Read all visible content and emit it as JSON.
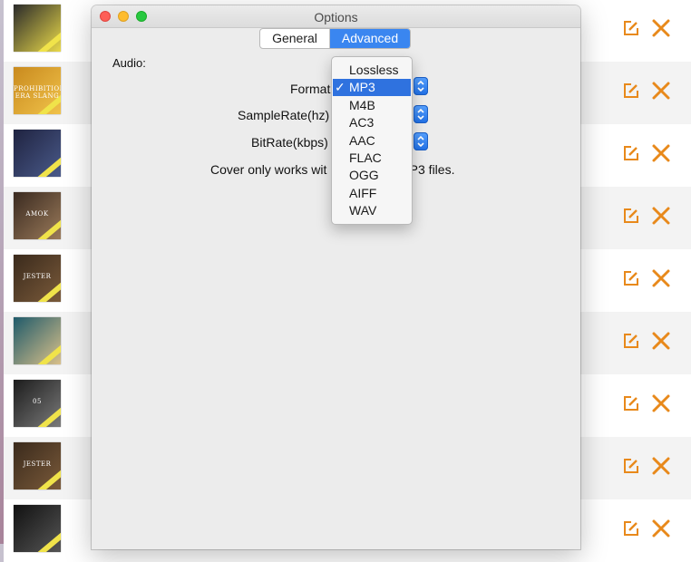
{
  "window": {
    "title": "Options"
  },
  "tabs": [
    {
      "label": "General",
      "active": false
    },
    {
      "label": "Advanced",
      "active": true
    }
  ],
  "audio": {
    "section_label": "Audio:",
    "format_label": "Format",
    "samplerate_label": "SampleRate(hz)",
    "bitrate_label": "BitRate(kbps)",
    "note_left": "Cover only works wit",
    "note_right": "MP3 files."
  },
  "format_menu": {
    "selected": "MP3",
    "options": [
      "Lossless",
      "MP3",
      "M4B",
      "AC3",
      "AAC",
      "FLAC",
      "OGG",
      "AIFF",
      "WAV"
    ]
  },
  "books": [
    {
      "cover_text": "",
      "colors": [
        "#2a2a2a",
        "#e9d94a"
      ]
    },
    {
      "cover_text": "PROHIBITION ERA SLANG",
      "colors": [
        "#c98a1e",
        "#f0c24a"
      ]
    },
    {
      "cover_text": "",
      "colors": [
        "#1f2340",
        "#4a5a8a"
      ]
    },
    {
      "cover_text": "AMOK",
      "colors": [
        "#3a2a20",
        "#9a7a5a"
      ]
    },
    {
      "cover_text": "JESTER",
      "colors": [
        "#3a2a1c",
        "#7a5a3a"
      ]
    },
    {
      "cover_text": "",
      "colors": [
        "#1f5a6a",
        "#d9c08a"
      ]
    },
    {
      "cover_text": "05",
      "colors": [
        "#1c1c1c",
        "#7a7a7a"
      ]
    },
    {
      "cover_text": "JESTER",
      "colors": [
        "#3a2a1c",
        "#7a5a3a"
      ]
    },
    {
      "cover_text": "",
      "colors": [
        "#111111",
        "#555555"
      ]
    }
  ],
  "accent": "#e8891b"
}
